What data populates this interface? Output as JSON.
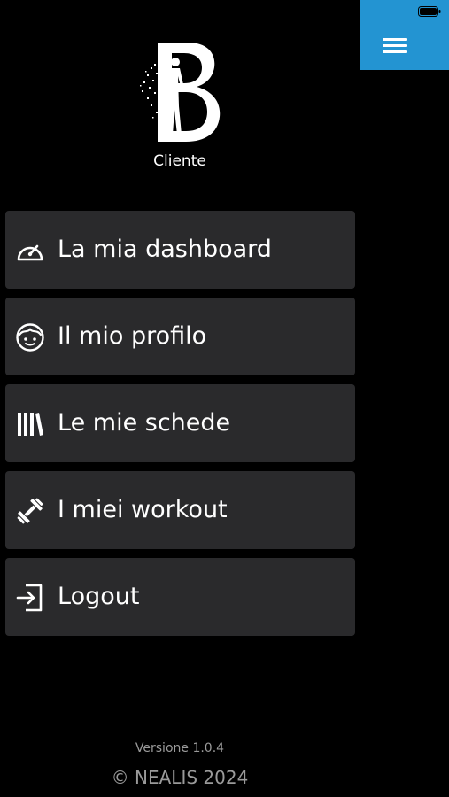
{
  "header": {
    "role": "Cliente"
  },
  "menu": {
    "items": [
      {
        "label": "La mia dashboard",
        "icon": "gauge-icon"
      },
      {
        "label": "Il mio profilo",
        "icon": "face-icon"
      },
      {
        "label": "Le mie schede",
        "icon": "books-icon"
      },
      {
        "label": "I miei workout",
        "icon": "dumbbell-icon"
      },
      {
        "label": "Logout",
        "icon": "logout-icon"
      }
    ]
  },
  "footer": {
    "version": "Versione 1.0.4",
    "copyright": "© NEALIS 2024"
  },
  "colors": {
    "accent": "#2394d2",
    "background": "#000000",
    "item_background": "#2a2a2c",
    "muted_text": "#9a9a9a"
  }
}
